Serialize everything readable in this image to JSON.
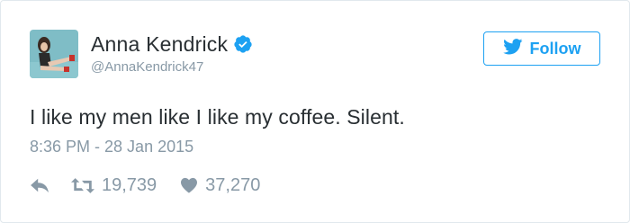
{
  "user": {
    "display_name": "Anna Kendrick",
    "handle": "@AnnaKendrick47",
    "verified": true
  },
  "follow_button": {
    "label": "Follow",
    "icon": "twitter-bird-icon"
  },
  "tweet": {
    "text": "I like my men like I like my coffee. Silent.",
    "timestamp": "8:36 PM - 28 Jan 2015"
  },
  "actions": {
    "reply_icon": "reply-icon",
    "retweet_icon": "retweet-icon",
    "retweet_count": "19,739",
    "like_icon": "heart-icon",
    "like_count": "37,270"
  },
  "colors": {
    "accent": "#1da1f2",
    "text": "#292f33",
    "muted": "#8899a6",
    "border": "#e1e8ed"
  }
}
